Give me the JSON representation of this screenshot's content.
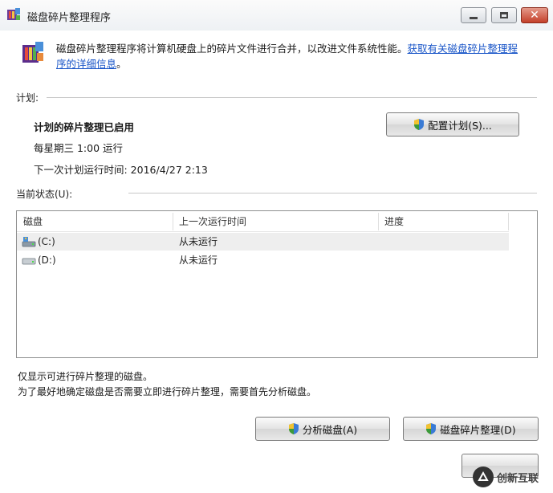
{
  "window": {
    "title": "磁盘碎片整理程序"
  },
  "description": {
    "line1_text": "磁盘碎片整理程序将计算机硬盘上的碎片文件进行合并，以改进文件系统性能。",
    "link_part1": "获取有关磁盘碎片整理程",
    "link_part2": "序的详细信息",
    "line2_suffix": "。"
  },
  "schedule": {
    "section_label": "计划:",
    "status": "计划的碎片整理已启用",
    "frequency": "每星期三 1:00 运行",
    "next_run": "下一次计划运行时间: 2016/4/27 2:13",
    "config_button": "配置计划(S)..."
  },
  "current_status": {
    "section_label": "当前状态(U):",
    "columns": [
      "磁盘",
      "上一次运行时间",
      "进度"
    ],
    "rows": [
      {
        "disk": "(C:)",
        "last_run": "从未运行",
        "progress": "",
        "icon": "system-drive-icon"
      },
      {
        "disk": "(D:)",
        "last_run": "从未运行",
        "progress": "",
        "icon": "hard-drive-icon"
      }
    ]
  },
  "notes": {
    "line1": "仅显示可进行碎片整理的磁盘。",
    "line2": "为了最好地确定磁盘是否需要立即进行碎片整理，需要首先分析磁盘。"
  },
  "actions": {
    "analyze_button": "分析磁盘(A)",
    "defrag_button": "磁盘碎片整理(D)",
    "close_button": ""
  },
  "watermark": {
    "text": "创新互联"
  },
  "colors": {
    "link": "#1a56c8",
    "close_button": "#c4402a"
  }
}
